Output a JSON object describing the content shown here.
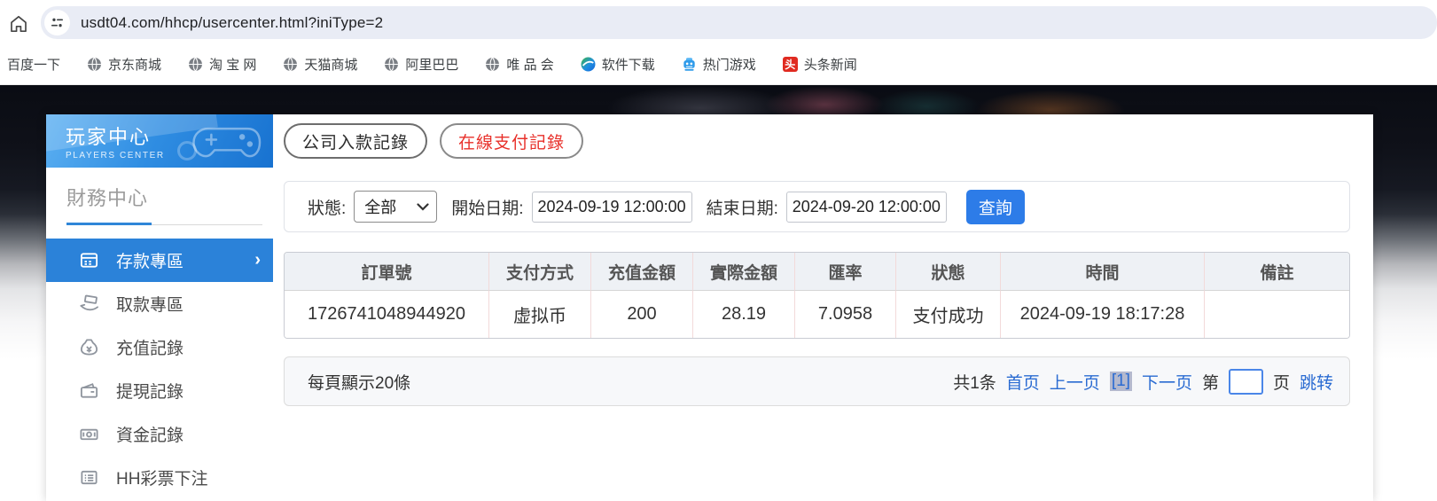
{
  "browser": {
    "url": "usdt04.com/hhcp/usercenter.html?iniType=2",
    "bookmarks": [
      {
        "label": "百度一下",
        "icon": "none"
      },
      {
        "label": "京东商城",
        "icon": "globe"
      },
      {
        "label": "淘 宝 网",
        "icon": "globe"
      },
      {
        "label": "天猫商城",
        "icon": "globe"
      },
      {
        "label": "阿里巴巴",
        "icon": "globe"
      },
      {
        "label": "唯 品 会",
        "icon": "globe"
      },
      {
        "label": "软件下载",
        "icon": "software"
      },
      {
        "label": "热门游戏",
        "icon": "game"
      },
      {
        "label": "头条新闻",
        "icon": "toutiao",
        "badge": "头"
      }
    ]
  },
  "sidebar": {
    "title": "玩家中心",
    "subtitle": "PLAYERS CENTER",
    "section_title": "財務中心",
    "items": [
      {
        "label": "存款專區",
        "icon": "deposit-card-icon",
        "active": true,
        "arrow": "›"
      },
      {
        "label": "取款專區",
        "icon": "withdraw-hand-icon",
        "active": false
      },
      {
        "label": "充值記錄",
        "icon": "money-bag-icon",
        "active": false
      },
      {
        "label": "提現記錄",
        "icon": "wallet-icon",
        "active": false
      },
      {
        "label": "資金記錄",
        "icon": "banknote-icon",
        "active": false
      },
      {
        "label": "HH彩票下注",
        "icon": "list-icon",
        "active": false
      }
    ]
  },
  "tabs": [
    {
      "label": "公司入款記錄",
      "active": false
    },
    {
      "label": "在線支付記錄",
      "active": true
    }
  ],
  "filter": {
    "status_label": "狀態:",
    "status_value": "全部",
    "start_label": "開始日期:",
    "start_value": "2024-09-19 12:00:00",
    "end_label": "結束日期:",
    "end_value": "2024-09-20 12:00:00",
    "query_label": "查詢"
  },
  "table": {
    "headers": [
      "訂單號",
      "支付方式",
      "充值金額",
      "實際金額",
      "匯率",
      "狀態",
      "時間",
      "備註"
    ],
    "rows": [
      [
        "1726741048944920",
        "虚拟币",
        "200",
        "28.19",
        "7.0958",
        "支付成功",
        "2024-09-19 18:17:28",
        ""
      ]
    ]
  },
  "pagination": {
    "per_page": "每頁顯示20條",
    "total": "共1条",
    "first": "首页",
    "prev": "上一页",
    "current": "[1]",
    "next": "下一页",
    "jump_label_pre": "第",
    "jump_label_post": "页",
    "jump": "跳转",
    "page_input_value": ""
  },
  "colors": {
    "sidebar_active_blue": "#2b82d9",
    "header_gradient_start": "#5cb0f2",
    "header_gradient_end": "#1872d0",
    "tab_active_red": "#e8302a",
    "query_button_blue": "#2d7ce8",
    "link_blue": "#2a6bd2",
    "table_header_bg": "#eef1f5",
    "table_divider_pink": "#f2dada"
  }
}
